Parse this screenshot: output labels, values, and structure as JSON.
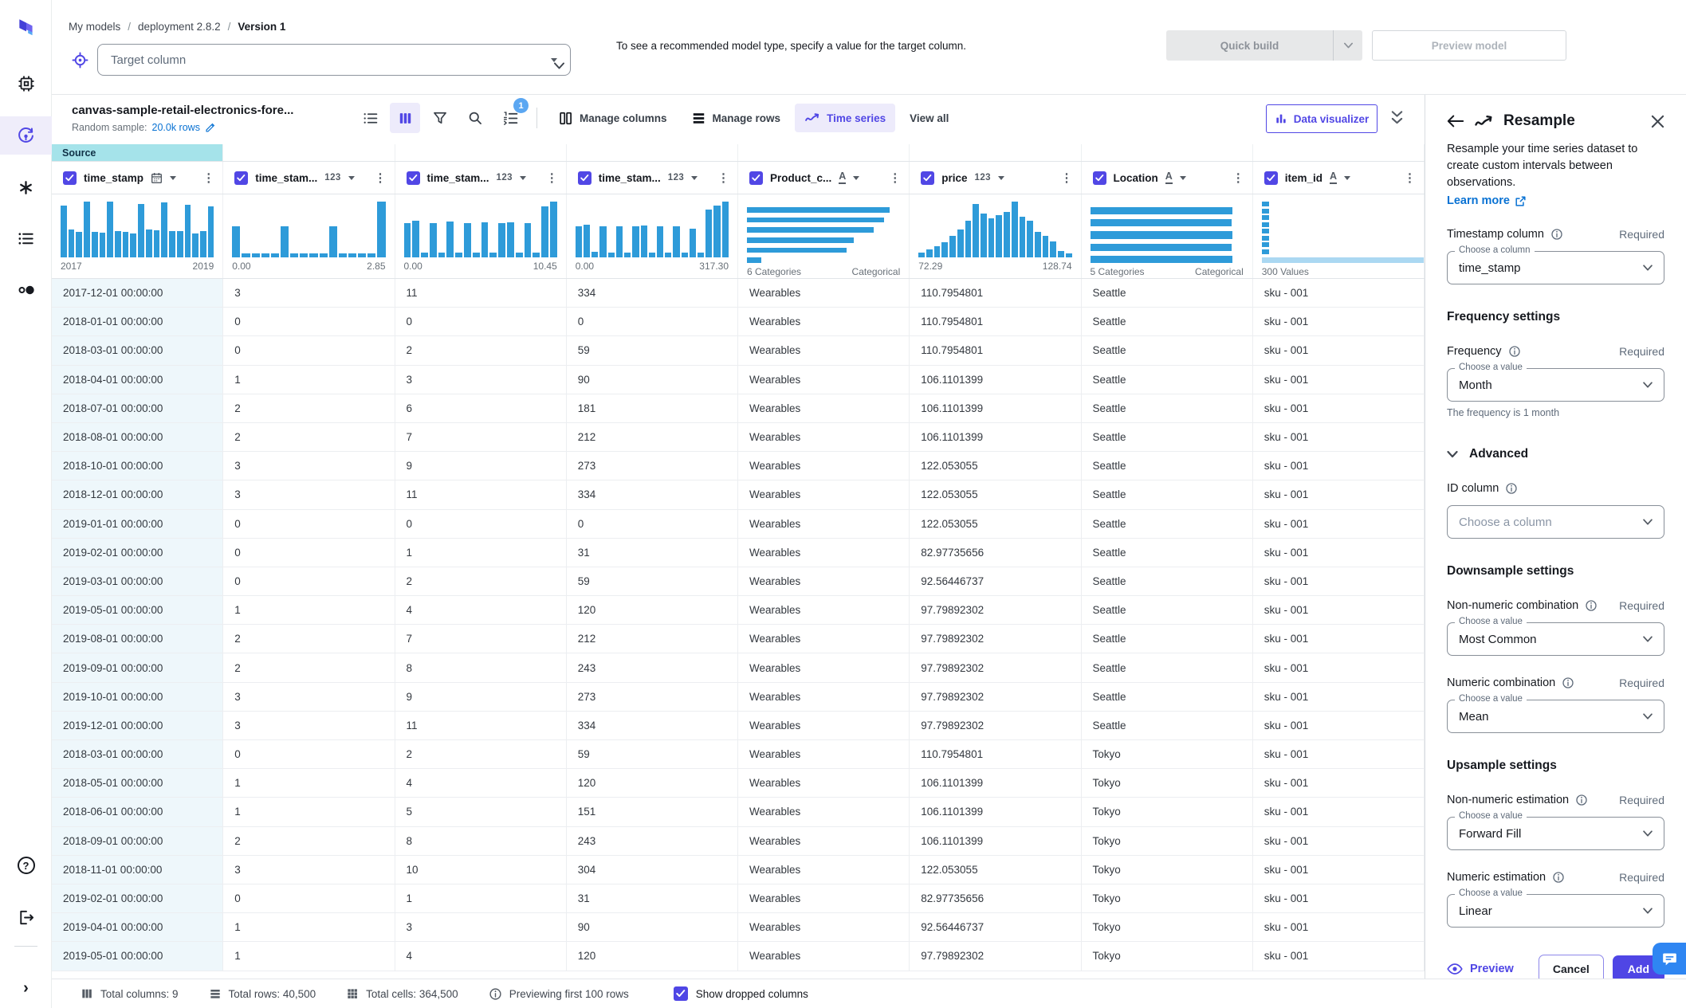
{
  "colors": {
    "accent": "#5147e5",
    "accent_light_bg": "#edebfb",
    "histogram_blue": "#2e9bd9",
    "histogram_light": "#abd8f2",
    "source_tab_bg": "#a5e3ea",
    "link_blue": "#0972d3",
    "badge_blue": "#5ba7f2",
    "add_button": "#4f46e5"
  },
  "sidebar": {
    "icons": [
      "canvas-logo",
      "chip-icon",
      "build-model-icon",
      "workflow-icon",
      "list-icon",
      "circles-icon",
      "help-icon",
      "logout-icon",
      "expand-icon"
    ],
    "active_icon": "build-model-icon"
  },
  "breadcrumb": {
    "items": [
      "My models",
      "deployment 2.8.2",
      "Version 1"
    ],
    "separator": "/"
  },
  "header": {
    "target_placeholder": "Target column",
    "hint": "To see a recommended model type, specify a value for the target column.",
    "quick_build_label": "Quick build",
    "preview_model_label": "Preview model"
  },
  "toolbar": {
    "dataset_title": "canvas-sample-retail-electronics-fore...",
    "sample_label": "Random sample:",
    "sample_value": "20.0k rows",
    "sort_badge": "1",
    "manage_columns_label": "Manage columns",
    "manage_rows_label": "Manage rows",
    "time_series_label": "Time series",
    "view_all_label": "View all",
    "data_visualizer_label": "Data visualizer"
  },
  "table": {
    "source_tab": "Source",
    "columns": [
      {
        "name": "time_stamp",
        "type_icon": "calendar-icon",
        "hist_type": "bars",
        "min": "2017",
        "max": "2019",
        "bars": [
          0.93,
          0.5,
          0.46,
          1,
          0.46,
          0.44,
          1,
          0.47,
          0.46,
          0.43,
          0.96,
          0.5,
          0.49,
          0.99,
          0.47,
          0.47,
          0.94,
          0.43,
          0.47,
          0.92
        ]
      },
      {
        "name": "time_stam...",
        "type_icon": "number-123",
        "hist_type": "bars",
        "min": "0.00",
        "max": "2.85",
        "bars": [
          0.56,
          0.07,
          0.07,
          0.07,
          0.07,
          0.56,
          0.07,
          0.07,
          0.07,
          0.07,
          0.55,
          0.07,
          0.07,
          0.07,
          0.07,
          1
        ]
      },
      {
        "name": "time_stam...",
        "type_icon": "number-123",
        "hist_type": "bars",
        "min": "0.00",
        "max": "10.45",
        "bars": [
          0.62,
          0.65,
          0.08,
          0.62,
          0.08,
          0.64,
          0.08,
          0.62,
          0.08,
          0.63,
          0.08,
          0.62,
          0.63,
          0.08,
          0.62,
          0.08,
          0.92,
          1
        ]
      },
      {
        "name": "time_stam...",
        "type_icon": "number-123",
        "hist_type": "bars",
        "min": "0.00",
        "max": "317.30",
        "bars": [
          0.56,
          0.58,
          0.1,
          0.55,
          0.08,
          0.56,
          0.08,
          0.55,
          0.57,
          0.08,
          0.55,
          0.08,
          0.55,
          0.08,
          0.52,
          0.08,
          0.86,
          0.93,
          1
        ]
      },
      {
        "name": "Product_c...",
        "type_icon": "text-A",
        "hist_type": "cats",
        "min": "6 Categories",
        "max": "Categorical",
        "bars": [
          1,
          0.96,
          0.89,
          0.75,
          0.7,
          0.1
        ]
      },
      {
        "name": "price",
        "type_icon": "number-123",
        "hist_type": "bars",
        "min": "72.29",
        "max": "128.74",
        "bars": [
          0.08,
          0.14,
          0.2,
          0.27,
          0.38,
          0.5,
          0.66,
          0.96,
          0.78,
          0.7,
          0.75,
          0.82,
          1,
          0.73,
          0.66,
          0.46,
          0.38,
          0.28,
          0.12,
          0.07
        ]
      },
      {
        "name": "Location",
        "type_icon": "text-A",
        "hist_type": "cats",
        "min": "5 Categories",
        "max": "Categorical",
        "bars": [
          1,
          0.99,
          1,
          0.99,
          1
        ]
      },
      {
        "name": "item_id",
        "type_icon": "text-A",
        "hist_type": "id",
        "min": "300 Values",
        "max": "",
        "bars": []
      }
    ],
    "rows": [
      [
        "2017-12-01 00:00:00",
        "3",
        "11",
        "334",
        "Wearables",
        "110.7954801",
        "Seattle",
        "sku - 001"
      ],
      [
        "2018-01-01 00:00:00",
        "0",
        "0",
        "0",
        "Wearables",
        "110.7954801",
        "Seattle",
        "sku - 001"
      ],
      [
        "2018-03-01 00:00:00",
        "0",
        "2",
        "59",
        "Wearables",
        "110.7954801",
        "Seattle",
        "sku - 001"
      ],
      [
        "2018-04-01 00:00:00",
        "1",
        "3",
        "90",
        "Wearables",
        "106.1101399",
        "Seattle",
        "sku - 001"
      ],
      [
        "2018-07-01 00:00:00",
        "2",
        "6",
        "181",
        "Wearables",
        "106.1101399",
        "Seattle",
        "sku - 001"
      ],
      [
        "2018-08-01 00:00:00",
        "2",
        "7",
        "212",
        "Wearables",
        "106.1101399",
        "Seattle",
        "sku - 001"
      ],
      [
        "2018-10-01 00:00:00",
        "3",
        "9",
        "273",
        "Wearables",
        "122.053055",
        "Seattle",
        "sku - 001"
      ],
      [
        "2018-12-01 00:00:00",
        "3",
        "11",
        "334",
        "Wearables",
        "122.053055",
        "Seattle",
        "sku - 001"
      ],
      [
        "2019-01-01 00:00:00",
        "0",
        "0",
        "0",
        "Wearables",
        "122.053055",
        "Seattle",
        "sku - 001"
      ],
      [
        "2019-02-01 00:00:00",
        "0",
        "1",
        "31",
        "Wearables",
        "82.97735656",
        "Seattle",
        "sku - 001"
      ],
      [
        "2019-03-01 00:00:00",
        "0",
        "2",
        "59",
        "Wearables",
        "92.56446737",
        "Seattle",
        "sku - 001"
      ],
      [
        "2019-05-01 00:00:00",
        "1",
        "4",
        "120",
        "Wearables",
        "97.79892302",
        "Seattle",
        "sku - 001"
      ],
      [
        "2019-08-01 00:00:00",
        "2",
        "7",
        "212",
        "Wearables",
        "97.79892302",
        "Seattle",
        "sku - 001"
      ],
      [
        "2019-09-01 00:00:00",
        "2",
        "8",
        "243",
        "Wearables",
        "97.79892302",
        "Seattle",
        "sku - 001"
      ],
      [
        "2019-10-01 00:00:00",
        "3",
        "9",
        "273",
        "Wearables",
        "97.79892302",
        "Seattle",
        "sku - 001"
      ],
      [
        "2019-12-01 00:00:00",
        "3",
        "11",
        "334",
        "Wearables",
        "97.79892302",
        "Seattle",
        "sku - 001"
      ],
      [
        "2018-03-01 00:00:00",
        "0",
        "2",
        "59",
        "Wearables",
        "110.7954801",
        "Tokyo",
        "sku - 001"
      ],
      [
        "2018-05-01 00:00:00",
        "1",
        "4",
        "120",
        "Wearables",
        "106.1101399",
        "Tokyo",
        "sku - 001"
      ],
      [
        "2018-06-01 00:00:00",
        "1",
        "5",
        "151",
        "Wearables",
        "106.1101399",
        "Tokyo",
        "sku - 001"
      ],
      [
        "2018-09-01 00:00:00",
        "2",
        "8",
        "243",
        "Wearables",
        "106.1101399",
        "Tokyo",
        "sku - 001"
      ],
      [
        "2018-11-01 00:00:00",
        "3",
        "10",
        "304",
        "Wearables",
        "122.053055",
        "Tokyo",
        "sku - 001"
      ],
      [
        "2019-02-01 00:00:00",
        "0",
        "1",
        "31",
        "Wearables",
        "82.97735656",
        "Tokyo",
        "sku - 001"
      ],
      [
        "2019-04-01 00:00:00",
        "1",
        "3",
        "90",
        "Wearables",
        "92.56446737",
        "Tokyo",
        "sku - 001"
      ],
      [
        "2019-05-01 00:00:00",
        "1",
        "4",
        "120",
        "Wearables",
        "97.79892302",
        "Tokyo",
        "sku - 001"
      ]
    ]
  },
  "panel": {
    "title": "Resample",
    "description": "Resample your time series dataset to create custom intervals between observations.",
    "learn_more": "Learn more",
    "required": "Required",
    "timestamp": {
      "label": "Timestamp column",
      "float_label": "Choose a column",
      "value": "time_stamp"
    },
    "frequency_settings_heading": "Frequency settings",
    "frequency": {
      "label": "Frequency",
      "float_label": "Choose a value",
      "value": "Month",
      "helper": "The frequency is 1 month"
    },
    "advanced_label": "Advanced",
    "id_column": {
      "label": "ID column",
      "placeholder": "Choose a column"
    },
    "downsample_heading": "Downsample settings",
    "non_numeric_combination": {
      "label": "Non-numeric combination",
      "float_label": "Choose a value",
      "value": "Most Common"
    },
    "numeric_combination": {
      "label": "Numeric combination",
      "float_label": "Choose a value",
      "value": "Mean"
    },
    "upsample_heading": "Upsample settings",
    "non_numeric_estimation": {
      "label": "Non-numeric estimation",
      "float_label": "Choose a value",
      "value": "Forward Fill"
    },
    "numeric_estimation": {
      "label": "Numeric estimation",
      "float_label": "Choose a value",
      "value": "Linear"
    },
    "preview_label": "Preview",
    "cancel_label": "Cancel",
    "add_label": "Add"
  },
  "footer": {
    "total_columns": "Total columns: 9",
    "total_rows": "Total rows: 40,500",
    "total_cells": "Total cells: 364,500",
    "previewing": "Previewing first 100 rows",
    "show_dropped": "Show dropped columns"
  }
}
